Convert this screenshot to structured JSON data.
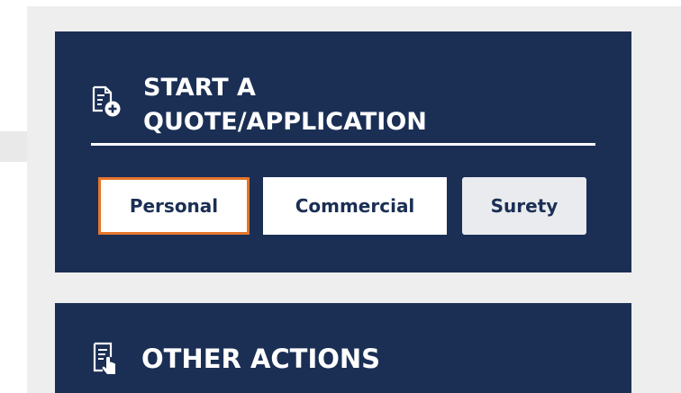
{
  "quote_card": {
    "icon": "document-add-icon",
    "title_line1": "START A",
    "title_line2": "QUOTE/APPLICATION",
    "buttons": [
      {
        "label": "Personal",
        "selected": true
      },
      {
        "label": "Commercial",
        "selected": false
      },
      {
        "label": "Surety",
        "selected": false
      }
    ]
  },
  "other_card": {
    "icon": "document-pointer-icon",
    "title": "OTHER ACTIONS"
  },
  "colors": {
    "card_background": "#1b2f55",
    "page_background": "#eeeeee",
    "selected_border": "#e5762b",
    "button_text": "#1b2f55",
    "surety_background": "#e9ebee"
  }
}
